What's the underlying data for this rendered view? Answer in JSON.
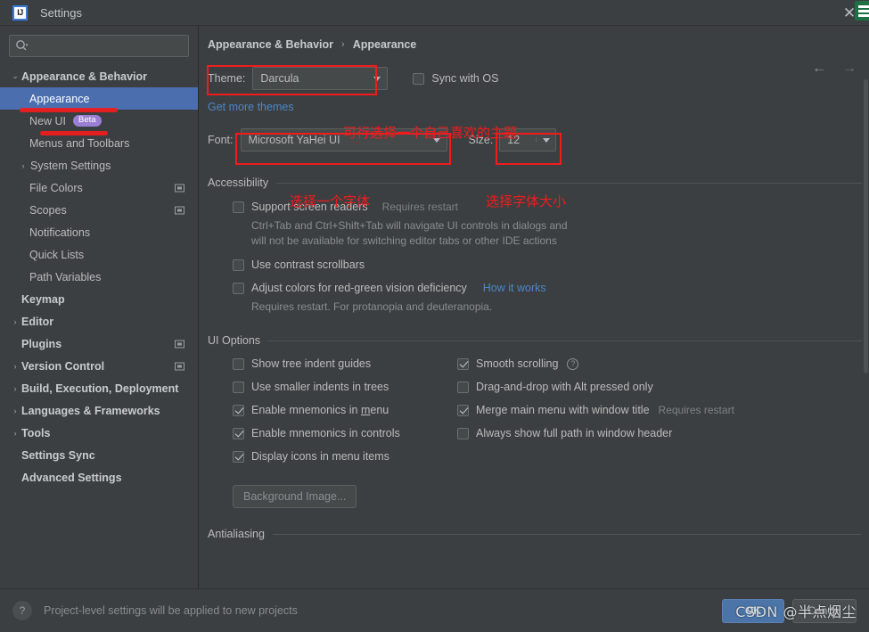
{
  "window": {
    "title": "Settings",
    "logo_text": "IJ",
    "close_icon": "✕"
  },
  "sidebar": {
    "search": {
      "placeholder": "",
      "value": "",
      "icon": "search-icon"
    },
    "items": [
      {
        "label": "Appearance & Behavior",
        "level": 0,
        "expandable": true,
        "expanded": true,
        "selected": false,
        "bold": true
      },
      {
        "label": "Appearance",
        "level": 1,
        "expandable": false,
        "selected": true,
        "bold": false
      },
      {
        "label": "New UI",
        "level": 1,
        "expandable": false,
        "selected": false,
        "bold": false,
        "badge": "Beta"
      },
      {
        "label": "Menus and Toolbars",
        "level": 1,
        "expandable": false,
        "selected": false,
        "bold": false
      },
      {
        "label": "System Settings",
        "level": 1,
        "expandable": true,
        "expanded": false,
        "selected": false,
        "bold": false
      },
      {
        "label": "File Colors",
        "level": 1,
        "expandable": false,
        "selected": false,
        "bold": false,
        "project_icon": true
      },
      {
        "label": "Scopes",
        "level": 1,
        "expandable": false,
        "selected": false,
        "bold": false,
        "project_icon": true
      },
      {
        "label": "Notifications",
        "level": 1,
        "expandable": false,
        "selected": false,
        "bold": false
      },
      {
        "label": "Quick Lists",
        "level": 1,
        "expandable": false,
        "selected": false,
        "bold": false
      },
      {
        "label": "Path Variables",
        "level": 1,
        "expandable": false,
        "selected": false,
        "bold": false
      },
      {
        "label": "Keymap",
        "level": 0,
        "expandable": false,
        "selected": false,
        "bold": true
      },
      {
        "label": "Editor",
        "level": 0,
        "expandable": true,
        "expanded": false,
        "selected": false,
        "bold": true
      },
      {
        "label": "Plugins",
        "level": 0,
        "expandable": false,
        "selected": false,
        "bold": true,
        "project_icon": true
      },
      {
        "label": "Version Control",
        "level": 0,
        "expandable": true,
        "expanded": false,
        "selected": false,
        "bold": true,
        "project_icon": true
      },
      {
        "label": "Build, Execution, Deployment",
        "level": 0,
        "expandable": true,
        "expanded": false,
        "selected": false,
        "bold": true
      },
      {
        "label": "Languages & Frameworks",
        "level": 0,
        "expandable": true,
        "expanded": false,
        "selected": false,
        "bold": true
      },
      {
        "label": "Tools",
        "level": 0,
        "expandable": true,
        "expanded": false,
        "selected": false,
        "bold": true
      },
      {
        "label": "Settings Sync",
        "level": 0,
        "expandable": false,
        "selected": false,
        "bold": true
      },
      {
        "label": "Advanced Settings",
        "level": 0,
        "expandable": false,
        "selected": false,
        "bold": true
      }
    ]
  },
  "main": {
    "breadcrumb": {
      "parent": "Appearance & Behavior",
      "separator": "›",
      "current": "Appearance"
    },
    "nav": {
      "back": "←",
      "forward": "→"
    },
    "theme": {
      "label": "Theme:",
      "value": "Darcula",
      "sync_with_os_label": "Sync with OS",
      "sync_with_os_checked": false,
      "get_more_themes": "Get more themes"
    },
    "font": {
      "label": "Font:",
      "value": "Microsoft YaHei UI",
      "size_label": "Size:",
      "size_value": "12"
    },
    "accessibility": {
      "title": "Accessibility",
      "screen_readers_label": "Support screen readers",
      "screen_readers_hint": "Requires restart",
      "screen_readers_checked": false,
      "screen_readers_desc_line1": "Ctrl+Tab and Ctrl+Shift+Tab will navigate UI controls in dialogs and",
      "screen_readers_desc_line2": "will not be available for switching editor tabs or other IDE actions",
      "contrast_scrollbars_label": "Use contrast scrollbars",
      "contrast_scrollbars_checked": false,
      "red_green_label": "Adjust colors for red-green vision deficiency",
      "red_green_checked": false,
      "how_it_works_link": "How it works",
      "red_green_desc": "Requires restart. For protanopia and deuteranopia."
    },
    "ui_options": {
      "title": "UI Options",
      "left": [
        {
          "label": "Show tree indent guides",
          "checked": false
        },
        {
          "label": "Use smaller indents in trees",
          "checked": false
        },
        {
          "label": "Enable mnemonics in menu",
          "checked": true,
          "mnemonic": "m"
        },
        {
          "label": "Enable mnemonics in controls",
          "checked": true
        },
        {
          "label": "Display icons in menu items",
          "checked": true
        }
      ],
      "right": [
        {
          "label": "Smooth scrolling",
          "checked": true,
          "help": "?"
        },
        {
          "label": "Drag-and-drop with Alt pressed only",
          "checked": false
        },
        {
          "label": "Merge main menu with window title",
          "checked": true,
          "hint": "Requires restart"
        },
        {
          "label": "Always show full path in window header",
          "checked": false
        }
      ],
      "background_image_button": "Background Image..."
    },
    "antialiasing": {
      "title": "Antialiasing"
    }
  },
  "annotations": {
    "theme_note": "可行选择一个自己喜欢的主题",
    "font_note": "选择一个字体",
    "size_note": "选择字体大小",
    "color": "#f01c1c"
  },
  "footer": {
    "help_icon": "?",
    "note": "Project-level settings will be applied to new projects",
    "ok_label": "OK",
    "cancel_label": "Cancel",
    "watermark": "CSDN @半点烟尘"
  }
}
